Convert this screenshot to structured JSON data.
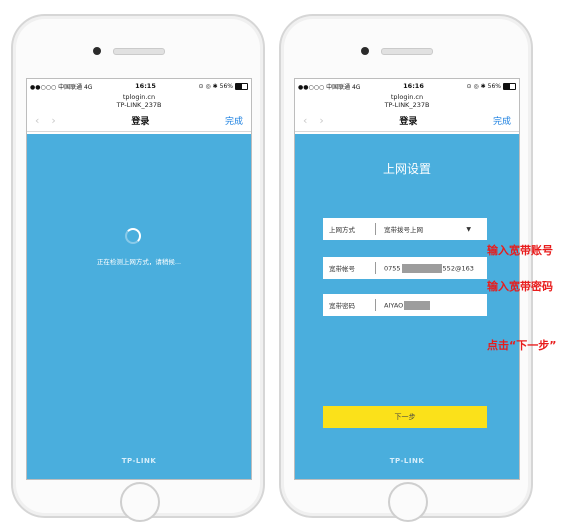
{
  "status": {
    "carrier": "●●○○○ 中国联通 4G",
    "time": "16:15",
    "battery": "56%"
  },
  "right_status": {
    "carrier": "●●○○○ 中国联通 4G",
    "time": "16:16",
    "battery": "56%"
  },
  "browser": {
    "url": "tplogin.cn",
    "page_title": "TP-LINK_237B",
    "nav_title": "登录",
    "done_label": "完成"
  },
  "left": {
    "detecting_text": "正在检测上网方式，请稍候...",
    "brand": "TP-LINK"
  },
  "right": {
    "form_title": "上网设置",
    "fields": [
      {
        "label": "上网方式",
        "value": "宽带拨号上网"
      },
      {
        "label": "宽带帐号",
        "value_prefix": "0755",
        "value_suffix": "552@163"
      },
      {
        "label": "宽带密码",
        "value_prefix": "AIYAO"
      }
    ],
    "next_label": "下一步",
    "brand": "TP-LINK"
  },
  "annotations": {
    "account": "输入宽带账号",
    "password": "输入宽带密码",
    "next": "点击“下一步”"
  },
  "colors": {
    "screen_bg": "#4aaedd",
    "button": "#fbe11a",
    "annotation": "#e81c1c",
    "link": "#1a7fe0"
  }
}
